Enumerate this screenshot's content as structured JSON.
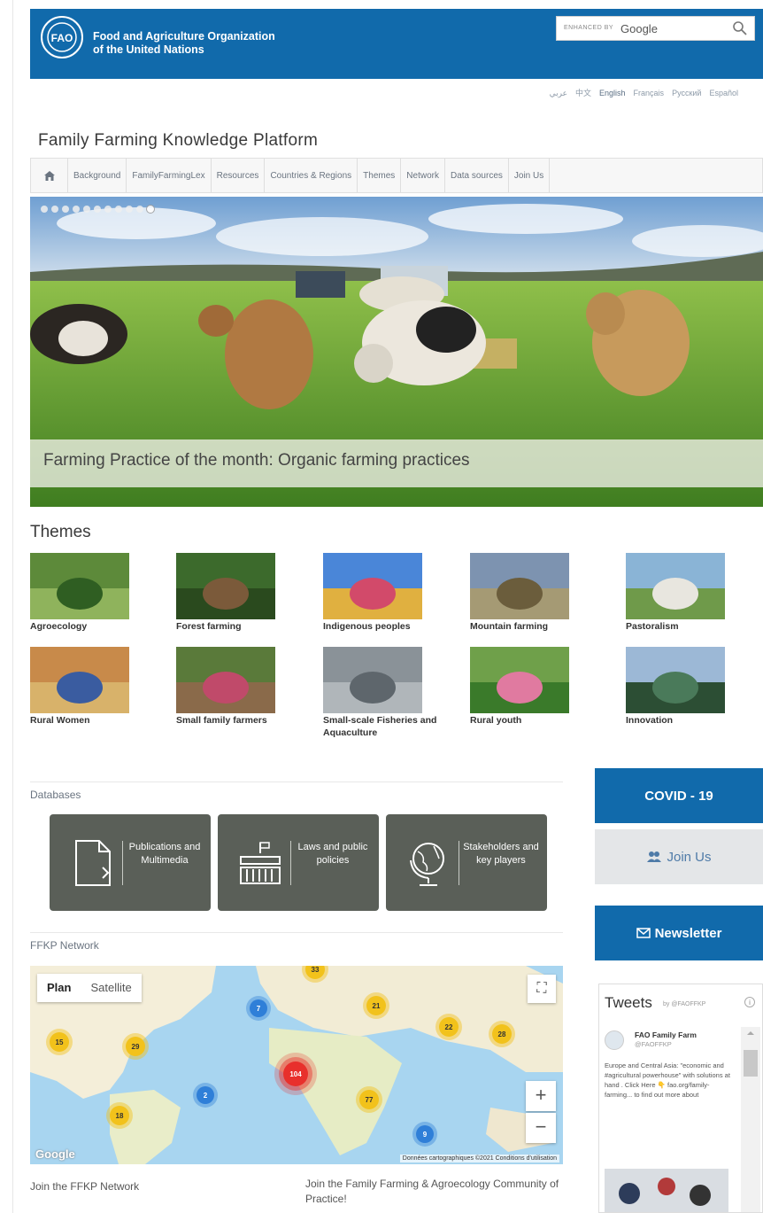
{
  "header": {
    "org_name_line1": "Food and Agriculture Organization",
    "org_name_line2": "of the United Nations",
    "search_powered": "ENHANCED BY",
    "search_brand": "Google"
  },
  "languages": [
    {
      "label": "عربي",
      "active": false
    },
    {
      "label": "中文",
      "active": false
    },
    {
      "label": "English",
      "active": true
    },
    {
      "label": "Français",
      "active": false
    },
    {
      "label": "Русский",
      "active": false
    },
    {
      "label": "Español",
      "active": false
    }
  ],
  "platform_title": "Family Farming Knowledge Platform",
  "nav": {
    "items": [
      "Background",
      "FamilyFarmingLex",
      "Resources",
      "Countries & Regions",
      "Themes",
      "Network",
      "Data sources",
      "Join Us"
    ]
  },
  "hero": {
    "slide_count": 11,
    "active_slide": 11,
    "caption": "Farming Practice of the month: Organic farming practices"
  },
  "themes": {
    "title": "Themes",
    "items": [
      "Agroecology",
      "Forest farming",
      "Indigenous peoples",
      "Mountain farming",
      "Pastoralism",
      "Rural Women",
      "Small family farmers",
      "Small-scale Fisheries and Aquaculture",
      "Rural youth",
      "Innovation"
    ]
  },
  "databases": {
    "title": "Databases",
    "cards": [
      {
        "label": "Publications and Multimedia",
        "icon": "document-icon"
      },
      {
        "label": "Laws and public policies",
        "icon": "building-icon"
      },
      {
        "label": "Stakeholders and key players",
        "icon": "globe-icon"
      }
    ]
  },
  "network": {
    "title": "FFKP Network",
    "map_tab_plan": "Plan",
    "map_tab_satellite": "Satellite",
    "google": "Google",
    "attribution": "Données cartographiques ©2021   Conditions d'utilisation",
    "zoom_in": "+",
    "zoom_out": "−",
    "fullscreen": "⛶",
    "clusters": [
      {
        "n": "15",
        "t": "y"
      },
      {
        "n": "29",
        "t": "y"
      },
      {
        "n": "7",
        "t": "b"
      },
      {
        "n": "33",
        "t": "y"
      },
      {
        "n": "21",
        "t": "y"
      },
      {
        "n": "22",
        "t": "y"
      },
      {
        "n": "28",
        "t": "y"
      },
      {
        "n": "2",
        "t": "b"
      },
      {
        "n": "18",
        "t": "y"
      },
      {
        "n": "104",
        "t": "r"
      },
      {
        "n": "77",
        "t": "y"
      },
      {
        "n": "9",
        "t": "b"
      }
    ]
  },
  "bottom_links": {
    "join_network": "Join the FFKP Network",
    "join_community": "Join the Family Farming & Agroecology Community of Practice!"
  },
  "sidebar": {
    "covid": "COVID - 19",
    "join": "Join Us",
    "newsletter": "Newsletter"
  },
  "tweets": {
    "title": "Tweets",
    "by": "by @FAOFFKP",
    "info": "i",
    "author": "FAO Family Farm",
    "handle": "@FAOFFKP",
    "body": "Europe and Central Asia: \"economic and #agricultural powerhouse\" with solutions at hand . Click Here 👇 fao.org/family-farming... to find out more about"
  },
  "colors": {
    "fao_blue": "#116aab",
    "db_card": "#5a5f58",
    "join_text": "#4f7ba8"
  }
}
